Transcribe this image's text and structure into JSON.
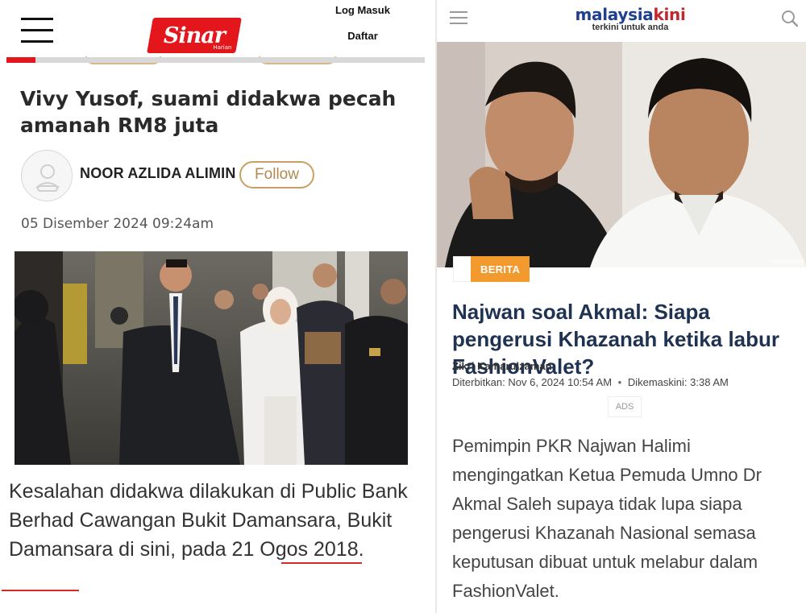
{
  "left": {
    "auth": {
      "login_label": "Log Masuk",
      "register_label": "Daftar"
    },
    "logo": {
      "word": "Sinar",
      "sub": "Harian"
    },
    "article": {
      "title": "Vivy Yusof, suami didakwa pecah amanah RM8 juta",
      "author": "NOOR AZLIDA ALIMIN",
      "follow_label": "Follow",
      "date": "05 Disember 2024 09:24am",
      "body_part1": "Kesalahan didakwa dilakukan di Public Bank Berhad Cawangan Bukit Damansara, Bukit Damansara di sini, pada ",
      "body_highlight": "21 Ogos 2018."
    },
    "reading_progress": 0.07,
    "colors": {
      "brand_red": "#e3161c",
      "accent_gold": "#c9a063"
    },
    "icons": [
      "menu-icon",
      "user-avatar-icon"
    ]
  },
  "right": {
    "logo": {
      "part1": "malaysia",
      "part2": "kini",
      "tagline": "terkini untuk anda"
    },
    "watermark": "malaysiakini",
    "badge": "BERITA",
    "article": {
      "title": "Najwan soal Akmal: Siapa pengerusi Khazanah ketika labur FashionValet?",
      "author": "Zikri Kamarulzaman",
      "published_label": "Diterbitkan:",
      "published_value": "Nov 6, 2024 10:54 AM",
      "separator": "•",
      "updated_label": "Dikemaskini:",
      "updated_value": "3:38 AM",
      "ads_label": "ADS",
      "body": "Pemimpin PKR Najwan Halimi mengingatkan Ketua Pemuda Umno Dr Akmal Saleh supaya tidak lupa siapa pengerusi Khazanah Nasional semasa keputusan dibuat untuk melabur dalam FashionValet."
    },
    "colors": {
      "brand_blue": "#1f3f8f",
      "brand_red": "#c1272d",
      "badge_orange": "#f29a2e",
      "title_navy": "#1f3252"
    },
    "icons": [
      "menu-icon",
      "search-icon"
    ]
  }
}
